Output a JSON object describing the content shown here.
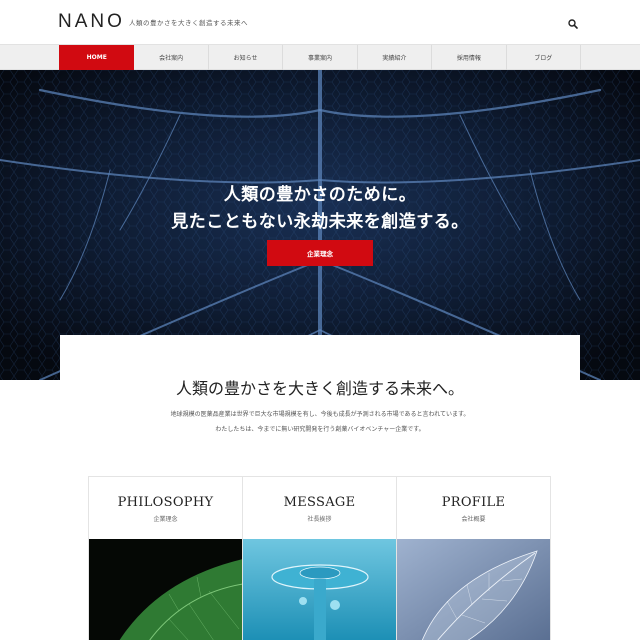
{
  "header": {
    "logo": "NANO",
    "tagline": "人類の豊かさを大きく創造する未来へ",
    "search_icon": "search-icon"
  },
  "nav": {
    "items": [
      {
        "label": "HOME",
        "active": true
      },
      {
        "label": "会社案内"
      },
      {
        "label": "お知らせ"
      },
      {
        "label": "事業案内"
      },
      {
        "label": "実績紹介"
      },
      {
        "label": "採用情報"
      },
      {
        "label": "ブログ"
      }
    ]
  },
  "hero": {
    "line1": "人類の豊かさのために。",
    "line2": "見たこともない永劫未来を創造する。",
    "button_label": "企業理念"
  },
  "intro": {
    "title": "人類の豊かさを大きく創造する未来へ。",
    "p1": "地球規模の医薬品産業は世界で巨大な市場規模を有し、今後も成長が予測される市場であると言われています。",
    "p2": "わたしたちは、今までに無い研究開発を行う創薬バイオベンチャー企業です。"
  },
  "cards": [
    {
      "title": "PHILOSOPHY",
      "sub": "企業理念"
    },
    {
      "title": "MESSAGE",
      "sub": "社長挨拶"
    },
    {
      "title": "PROFILE",
      "sub": "会社概要"
    }
  ],
  "colors": {
    "accent": "#d10a11",
    "nav_bg": "#efefef",
    "hero_bg": "#0b1320"
  }
}
